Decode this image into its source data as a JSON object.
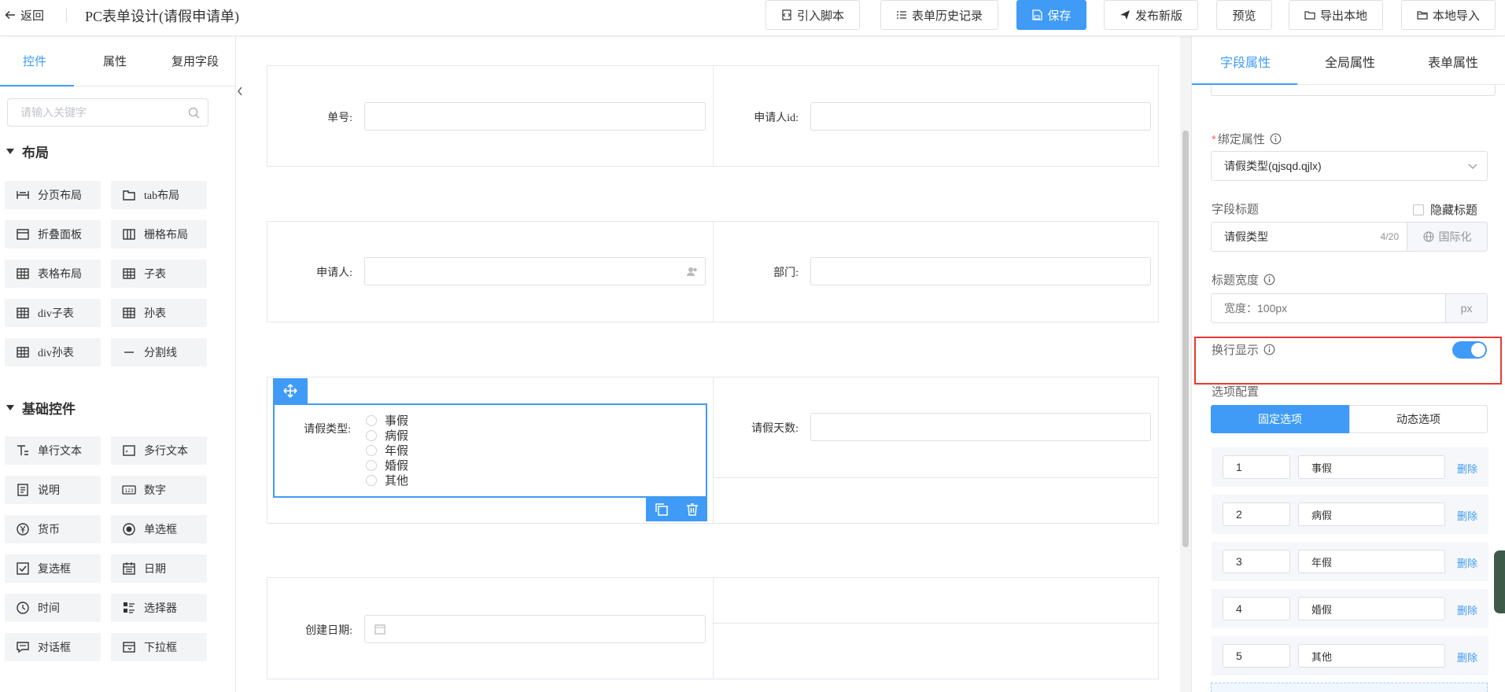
{
  "header": {
    "back_label": "返回",
    "title": "PC表单设计(请假申请单)",
    "buttons": {
      "import_script": "引入脚本",
      "history": "表单历史记录",
      "save": "保存",
      "publish": "发布新版",
      "preview": "预览",
      "export": "导出本地",
      "import": "本地导入"
    }
  },
  "left_panel": {
    "tabs": [
      "控件",
      "属性",
      "复用字段"
    ],
    "active_tab": "控件",
    "search_placeholder": "请输入关键字",
    "layout_section": "布局",
    "layout_controls": [
      "分页布局",
      "tab布局",
      "折叠面板",
      "栅格布局",
      "表格布局",
      "子表",
      "div子表",
      "孙表",
      "div孙表",
      "分割线"
    ],
    "basic_section": "基础控件",
    "basic_controls": [
      "单行文本",
      "多行文本",
      "说明",
      "数字",
      "货币",
      "单选框",
      "复选框",
      "日期",
      "时间",
      "选择器",
      "对话框",
      "下拉框"
    ]
  },
  "form": {
    "fields": {
      "order_no": "单号:",
      "applicant_id": "申请人id:",
      "applicant": "申请人:",
      "department": "部门:",
      "leave_type": "请假类型:",
      "leave_days": "请假天数:",
      "created_date": "创建日期:"
    },
    "leave_type_options": [
      "事假",
      "病假",
      "年假",
      "婚假",
      "其他"
    ]
  },
  "right_panel": {
    "tabs": [
      "字段属性",
      "全局属性",
      "表单属性"
    ],
    "active_tab": "字段属性",
    "bind_label": "绑定属性",
    "bind_value": "请假类型(qjsqd.qjlx)",
    "field_title_label": "字段标题",
    "hide_title_label": "隐藏标题",
    "field_title_value": "请假类型",
    "field_title_count": "4/20",
    "i18n_label": "国际化",
    "title_width_label": "标题宽度",
    "title_width_placeholder": "宽度：100px",
    "title_width_unit": "px",
    "wrap_display_label": "换行显示",
    "wrap_display_on": true,
    "options_config_label": "选项配置",
    "option_modes": [
      "固定选项",
      "动态选项"
    ],
    "active_mode": "固定选项",
    "options": [
      {
        "value": "1",
        "label": "事假"
      },
      {
        "value": "2",
        "label": "病假"
      },
      {
        "value": "3",
        "label": "年假"
      },
      {
        "value": "4",
        "label": "婚假"
      },
      {
        "value": "5",
        "label": "其他"
      }
    ],
    "delete_label": "删除"
  },
  "colors": {
    "accent": "#3f9bf5",
    "highlight_border": "#e53935",
    "required": "#f56c6c"
  }
}
